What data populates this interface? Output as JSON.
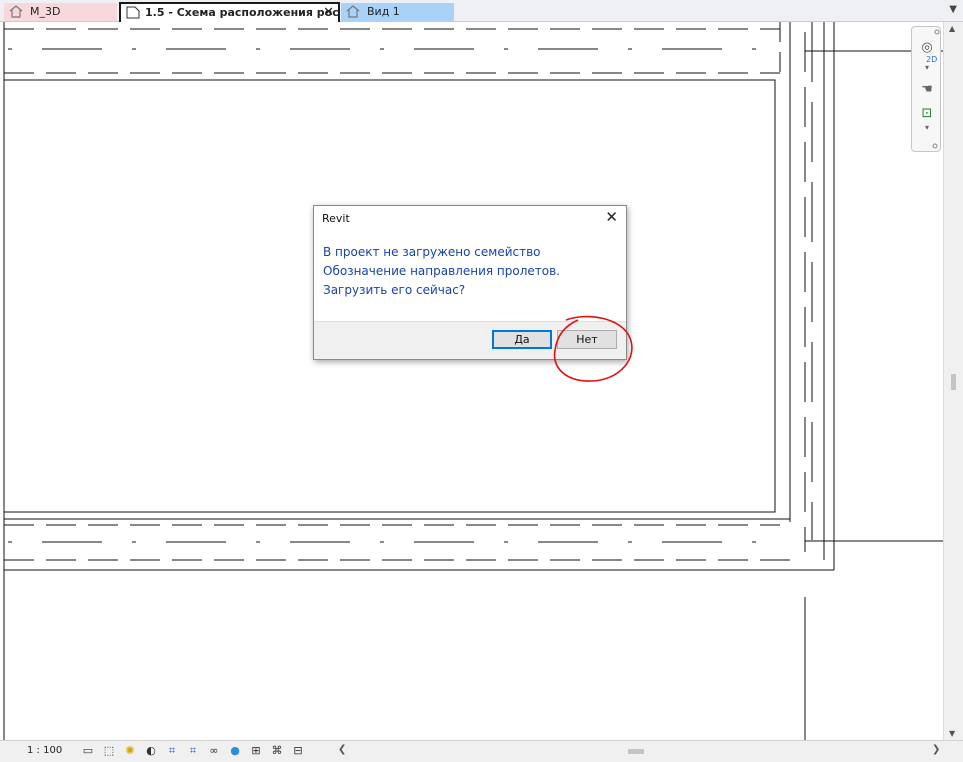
{
  "tabs": [
    {
      "label": "M_3D",
      "icon": "home-icon"
    },
    {
      "label": "1.5 - Схема расположения рост…",
      "icon": "sheet-icon",
      "active": true
    },
    {
      "label": "Вид 1",
      "icon": "home-icon"
    }
  ],
  "navbar": {
    "mode_label": "2D",
    "tools": [
      "steering-wheel-icon",
      "pan-icon",
      "zoom-region-icon",
      "zoom-icon"
    ]
  },
  "status": {
    "scale": "1 : 100",
    "icons": [
      "detail-level-icon",
      "visual-style-icon",
      "sun-path-icon",
      "shadows-icon",
      "crop-view-icon",
      "show-crop-icon",
      "temporary-hide-icon",
      "reveal-hidden-icon",
      "lock-3d-icon",
      "temporary-view-icon",
      "analytical-model-icon",
      "highlight-displacement-icon"
    ]
  },
  "dialog": {
    "title": "Revit",
    "message": [
      "В проект не загружено семейство",
      "Обозначение направления пролетов.",
      "Загрузить его сейчас?"
    ],
    "yes_label": "Да",
    "no_label": "Нет"
  },
  "colors": {
    "active_tab_border": "#1a1a1a",
    "m3d_tab": "#f7d9dc",
    "view_tab": "#a8d2f7",
    "message_text": "#1a44a8",
    "annotation": "#e01010"
  }
}
